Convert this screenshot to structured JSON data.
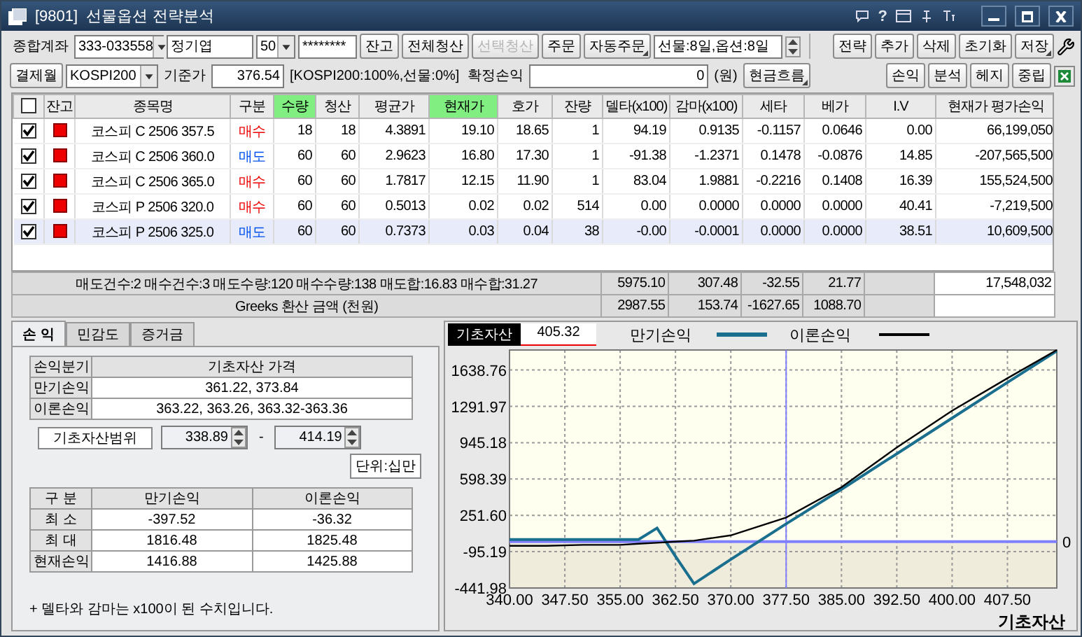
{
  "window": {
    "title": "[9801]  선물옵션 전략분석",
    "help": "?"
  },
  "toolbar": {
    "account_label": "종합계좌",
    "account": "333-033558",
    "name": "정기엽",
    "count": "50",
    "password": "********",
    "buttons": [
      {
        "label": "잔고",
        "disabled": false,
        "menu": false
      },
      {
        "label": "전체청산",
        "disabled": false,
        "menu": false
      },
      {
        "label": "선택청산",
        "disabled": true,
        "menu": false
      },
      {
        "label": "주문",
        "disabled": false,
        "menu": false
      },
      {
        "label": "자동주문",
        "disabled": false,
        "menu": true
      }
    ],
    "days": "선물:8일,옵션:8일",
    "right_buttons": [
      {
        "label": "전략",
        "disabled": false,
        "menu": false
      },
      {
        "label": "추가",
        "disabled": false,
        "menu": false
      },
      {
        "label": "삭제",
        "disabled": false,
        "menu": false
      },
      {
        "label": "초기화",
        "disabled": false,
        "menu": false
      },
      {
        "label": "저장",
        "disabled": false,
        "menu": true
      }
    ],
    "month_button": "결제월",
    "underlying": "KOSPI200",
    "base_label": "기준가",
    "base_price": "376.54",
    "ratio": "[KOSPI200:100%,선물:0%]",
    "realized_label": "확정손익",
    "realized": "0",
    "unit": "(원)",
    "cashflow_button": "현금흐름",
    "right_buttons2": [
      {
        "label": "손익",
        "disabled": false,
        "menu": false
      },
      {
        "label": "분석",
        "disabled": false,
        "menu": false
      },
      {
        "label": "헤지",
        "disabled": false,
        "menu": false
      },
      {
        "label": "중립",
        "disabled": false,
        "menu": false
      }
    ]
  },
  "table": {
    "all_checked": false,
    "columns": [
      {
        "label": "잔고",
        "highlight": false
      },
      {
        "label": "종목명",
        "highlight": false
      },
      {
        "label": "구분",
        "highlight": false
      },
      {
        "label": "수량",
        "highlight": true
      },
      {
        "label": "청산",
        "highlight": false
      },
      {
        "label": "평균가",
        "highlight": false
      },
      {
        "label": "현재가",
        "highlight": true
      },
      {
        "label": "호가",
        "highlight": false
      },
      {
        "label": "잔량",
        "highlight": false
      },
      {
        "label": "델타(x100)",
        "highlight": false
      },
      {
        "label": "감마(x100)",
        "highlight": false
      },
      {
        "label": "세타",
        "highlight": false
      },
      {
        "label": "베가",
        "highlight": false
      },
      {
        "label": "I.V",
        "highlight": false
      },
      {
        "label": "현재가 평가손익",
        "highlight": false
      }
    ],
    "rows": [
      {
        "checked": true,
        "selected": false,
        "kind": "buy",
        "cells": [
          "",
          "코스피 C 2506 357.5",
          "매수",
          "18",
          "18",
          "4.3891",
          "19.10",
          "18.65",
          "1",
          "94.19",
          "0.9135",
          "-0.1157",
          "0.0646",
          "0.00",
          "66,199,050"
        ]
      },
      {
        "checked": true,
        "selected": false,
        "kind": "sell",
        "cells": [
          "",
          "코스피 C 2506 360.0",
          "매도",
          "60",
          "60",
          "2.9623",
          "16.80",
          "17.30",
          "1",
          "-91.38",
          "-1.2371",
          "0.1478",
          "-0.0876",
          "14.85",
          "-207,565,500"
        ]
      },
      {
        "checked": true,
        "selected": false,
        "kind": "buy",
        "cells": [
          "",
          "코스피 C 2506 365.0",
          "매수",
          "60",
          "60",
          "1.7817",
          "12.15",
          "11.90",
          "1",
          "83.04",
          "1.9881",
          "-0.2216",
          "0.1408",
          "16.39",
          "155,524,500"
        ]
      },
      {
        "checked": true,
        "selected": false,
        "kind": "buy",
        "cells": [
          "",
          "코스피 P 2506 320.0",
          "매수",
          "60",
          "60",
          "0.5013",
          "0.02",
          "0.02",
          "514",
          "0.00",
          "0.0000",
          "0.0000",
          "0.0000",
          "40.41",
          "-7,219,500"
        ]
      },
      {
        "checked": true,
        "selected": true,
        "kind": "sell",
        "cells": [
          "",
          "코스피 P 2506 325.0",
          "매도",
          "60",
          "60",
          "0.7373",
          "0.03",
          "0.04",
          "38",
          "-0.00",
          "-0.0001",
          "0.0000",
          "0.0000",
          "38.51",
          "10,609,500"
        ]
      }
    ],
    "summary": [
      {
        "text": "매도건수:2 매수건수:3 매도수량:120 매수수량:138 매도합:16.83 매수합:31.27",
        "cells": [
          "5975.10",
          "307.48",
          "-32.55",
          "21.77"
        ],
        "pnl": "17,548,032"
      },
      {
        "text": "Greeks 환산 금액 (천원)",
        "cells": [
          "2987.55",
          "153.74",
          "-1627.65",
          "1088.70"
        ]
      }
    ]
  },
  "panel": {
    "tabs": [
      {
        "label": "손 익",
        "selected": true
      },
      {
        "label": "민감도",
        "selected": false
      },
      {
        "label": "증거금",
        "selected": false
      }
    ],
    "breakeven": {
      "columns": [
        "손익분기",
        "기초자산 가격"
      ],
      "rows": [
        {
          "label": "만기손익",
          "value": "361.22, 373.84"
        },
        {
          "label": "이론손익",
          "value": "363.22, 363.26, 363.32-363.36"
        }
      ]
    },
    "range": {
      "label": "기초자산범위",
      "from": "338.89",
      "separator": "-",
      "to": "414.19"
    },
    "unit": "단위:십만",
    "stats": {
      "columns": [
        "구 분",
        "만기손익",
        "이론손익"
      ],
      "rows": [
        [
          "최 소",
          "-397.52",
          "-36.32"
        ],
        [
          "최 대",
          "1816.48",
          "1825.48"
        ],
        [
          "현재손익",
          "1416.88",
          "1425.88"
        ]
      ]
    },
    "note": "+ 델타와 감마는 x100이 된 수치입니다."
  },
  "chart": {
    "cursor": {
      "label": "기초자산",
      "value": "405.32"
    },
    "chart_data": {
      "type": "line",
      "xlabel": "기초자산",
      "x": [
        340,
        345,
        350,
        355,
        357.5,
        360,
        362.5,
        365,
        370,
        377.5,
        385,
        392.5,
        400,
        407.5,
        414.19
      ],
      "series": [
        {
          "name": "만기손익",
          "color": "#1a6f8f",
          "values": [
            20,
            20,
            20,
            20,
            20,
            130,
            -140,
            -400,
            -170,
            170,
            500,
            840,
            1180,
            1520,
            1820
          ]
        },
        {
          "name": "이론손익",
          "color": "#000000",
          "values": [
            -40,
            -40,
            -30,
            -30,
            -20,
            -10,
            0,
            10,
            60,
            230,
            520,
            900,
            1250,
            1560,
            1830
          ]
        }
      ],
      "xlim": [
        340,
        414.19
      ],
      "ylim": [
        -441.98,
        1830
      ],
      "grid": true,
      "legend": "top",
      "xticks": [
        {
          "value": 340,
          "label": "340.00"
        },
        {
          "value": 347.5,
          "label": "347.50"
        },
        {
          "value": 355,
          "label": "355.00"
        },
        {
          "value": 362.5,
          "label": "362.50"
        },
        {
          "value": 370,
          "label": "370.00"
        },
        {
          "value": 377.5,
          "label": "377.50"
        },
        {
          "value": 385,
          "label": "385.00"
        },
        {
          "value": 392.5,
          "label": "392.50"
        },
        {
          "value": 400,
          "label": "400.00"
        },
        {
          "value": 407.5,
          "label": "407.50"
        }
      ],
      "yticks": [
        {
          "value": -441.98,
          "label": "-441.98"
        },
        {
          "value": -95.19,
          "label": "-95.19"
        },
        {
          "value": 251.6,
          "label": "251.60"
        },
        {
          "value": 598.39,
          "label": "598.39"
        },
        {
          "value": 945.18,
          "label": "945.18"
        },
        {
          "value": 1291.97,
          "label": "1291.97"
        },
        {
          "value": 1638.76,
          "label": "1638.76"
        }
      ],
      "bands": [
        {
          "axis": "y",
          "from": 0,
          "to": 1830,
          "color": "#fffff0"
        },
        {
          "axis": "y",
          "from": -441.98,
          "to": 0,
          "color": "#efecdc"
        }
      ],
      "ref_lines": [
        {
          "axis": "y",
          "value": 0,
          "label": "0"
        },
        {
          "axis": "x",
          "value": 377.5
        }
      ]
    }
  }
}
